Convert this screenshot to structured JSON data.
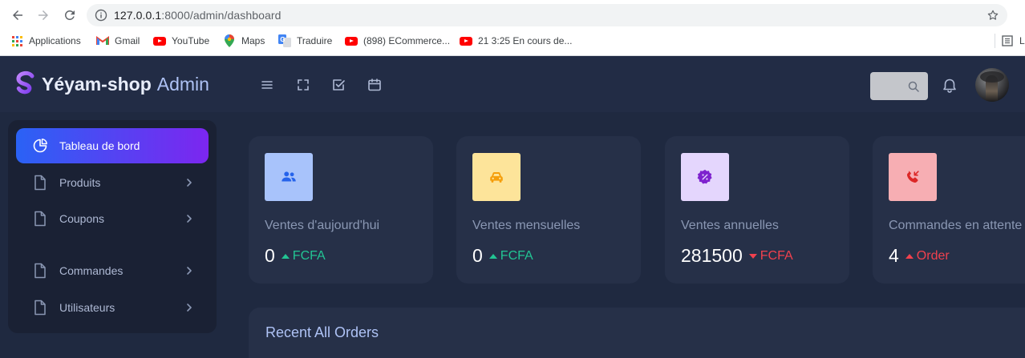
{
  "browser": {
    "url_host": "127.0.0.1",
    "url_rest": ":8000/admin/dashboard",
    "bookmarks": [
      {
        "label": "Applications",
        "icon": "apps-grid-icon"
      },
      {
        "label": "Gmail",
        "icon": "gmail-icon"
      },
      {
        "label": "YouTube",
        "icon": "youtube-icon"
      },
      {
        "label": "Maps",
        "icon": "maps-icon"
      },
      {
        "label": "Traduire",
        "icon": "translate-icon"
      },
      {
        "label": "(898) ECommerce...",
        "icon": "youtube-icon"
      },
      {
        "label": "21 3:25 En cours de...",
        "icon": "youtube-icon"
      }
    ],
    "reading_list_label": "Li"
  },
  "header": {
    "brand_name": "Yéyam-shop",
    "brand_suffix": "Admin",
    "toolbar_icons": [
      "menu-icon",
      "fullscreen-icon",
      "checklist-icon",
      "calendar-icon"
    ],
    "search_placeholder": "",
    "accent_gradient": [
      "#2a62f5",
      "#7c26f0"
    ]
  },
  "sidebar": {
    "items": [
      {
        "label": "Tableau de bord",
        "icon": "pie-chart-icon",
        "active": true
      },
      {
        "label": "Produits",
        "icon": "file-icon",
        "has_submenu": true
      },
      {
        "label": "Coupons",
        "icon": "file-icon",
        "has_submenu": true
      },
      {
        "label": "Commandes",
        "icon": "file-icon",
        "has_submenu": true
      },
      {
        "label": "Utilisateurs",
        "icon": "file-icon",
        "has_submenu": true
      }
    ]
  },
  "stats": [
    {
      "title": "Ventes d'aujourd'hui",
      "value": "0",
      "unit": "FCFA",
      "trend": "up",
      "trend_color": "#22c493",
      "icon": "users-icon",
      "icon_bg": "#a8c3fb",
      "icon_color": "#2563eb"
    },
    {
      "title": "Ventes mensuelles",
      "value": "0",
      "unit": "FCFA",
      "trend": "up",
      "trend_color": "#22c493",
      "icon": "car-icon",
      "icon_bg": "#fde49a",
      "icon_color": "#f59e0b"
    },
    {
      "title": "Ventes annuelles",
      "value": "281500",
      "unit": "FCFA",
      "trend": "down",
      "trend_color": "#f0414e",
      "icon": "discount-badge-icon",
      "icon_bg": "#e4d6fd",
      "icon_color": "#7e22ce"
    },
    {
      "title": "Commandes en attente",
      "value": "4",
      "unit": "Order",
      "trend": "up",
      "trend_color": "#f0414e",
      "icon": "phone-incoming-icon",
      "icon_bg": "#f7aeb3",
      "icon_color": "#dc2626"
    }
  ],
  "orders": {
    "title": "Recent All Orders"
  }
}
